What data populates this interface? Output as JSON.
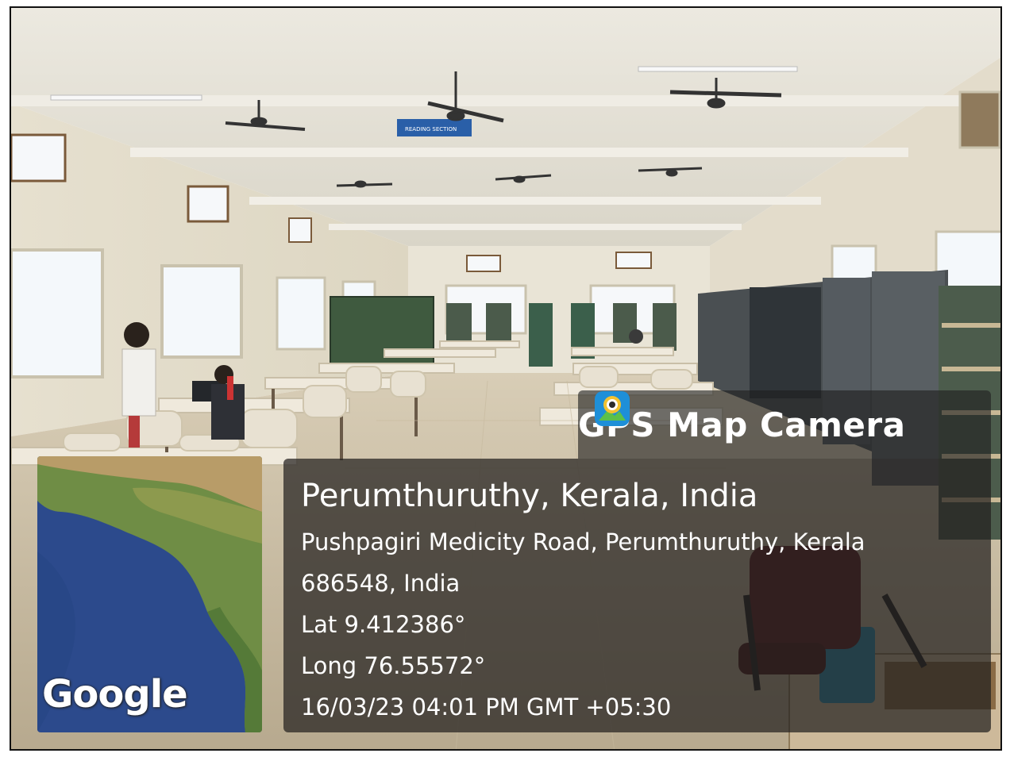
{
  "app": {
    "brand_label": "GPS Map Camera",
    "brand_icon": "camera-pin-icon"
  },
  "location": {
    "title": "Perumthuruthy, Kerala, India",
    "address_line1": "Pushpagiri Medicity Road, Perumthuruthy, Kerala",
    "address_line2": "686548, India",
    "latitude": "Lat 9.412386°",
    "longitude": "Long 76.55572°",
    "datetime": "16/03/23 04:01 PM GMT +05:30"
  },
  "map": {
    "attribution": "Google"
  },
  "scene": {
    "sign_text": "READING SECTION"
  },
  "colors": {
    "overlay_bg": "#23201e",
    "text": "#ffffff",
    "map_ocean": "#2c4a8c",
    "map_land": "#6f8d45",
    "sign_blue": "#2a5fa8"
  }
}
